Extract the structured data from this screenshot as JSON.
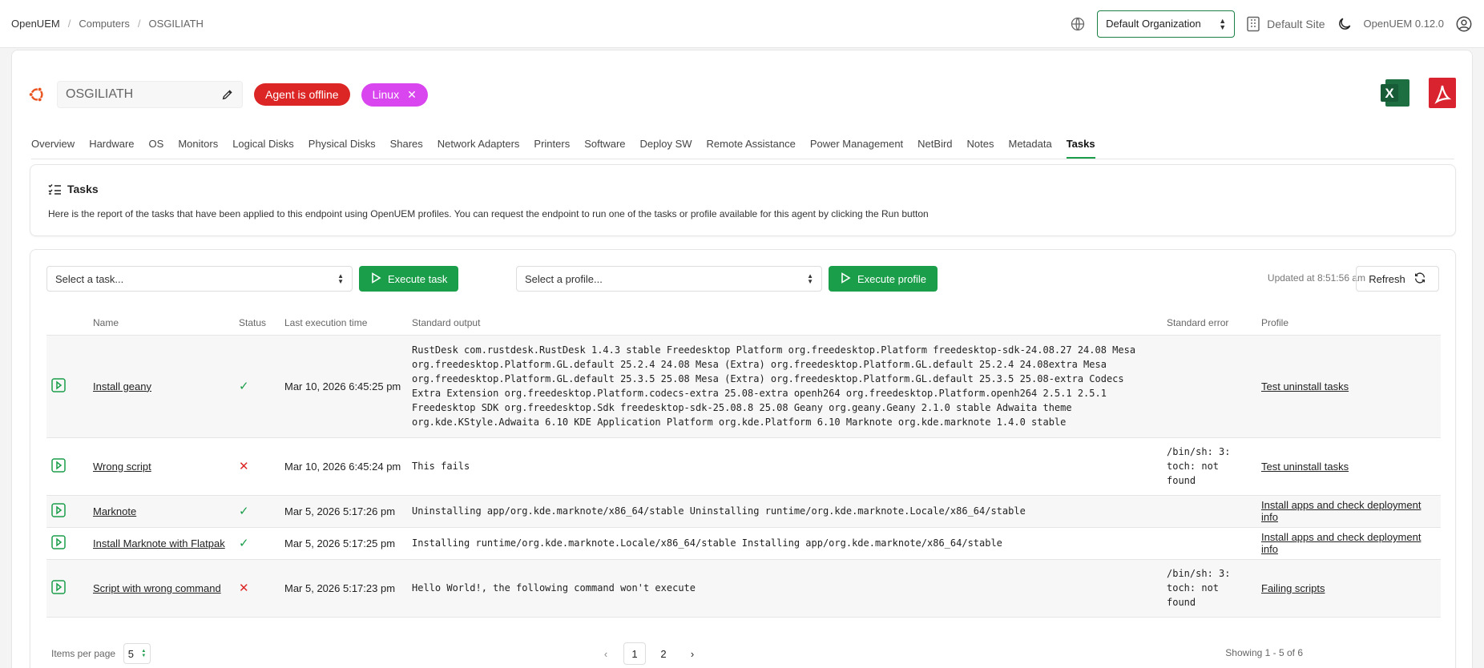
{
  "breadcrumb": {
    "items": [
      "OpenUEM",
      "Computers",
      "OSGILIATH"
    ]
  },
  "header": {
    "org_label": "Default Organization",
    "site_label": "Default Site",
    "version": "OpenUEM 0.12.0"
  },
  "endpoint": {
    "name": "OSGILIATH",
    "status_badge": "Agent is offline",
    "os_badge": "Linux"
  },
  "colors": {
    "accent": "#1a9e4a",
    "offline": "#dc2626",
    "os_badge": "#d946ef",
    "excel": "#1d6f42",
    "pdf": "#d9232e"
  },
  "tabs": [
    "Overview",
    "Hardware",
    "OS",
    "Monitors",
    "Logical Disks",
    "Physical Disks",
    "Shares",
    "Network Adapters",
    "Printers",
    "Software",
    "Deploy SW",
    "Remote Assistance",
    "Power Management",
    "NetBird",
    "Notes",
    "Metadata",
    "Tasks"
  ],
  "active_tab": "Tasks",
  "tasks_panel": {
    "title": "Tasks",
    "description": "Here is the report of the tasks that have been applied to this endpoint using OpenUEM profiles. You can request the endpoint to run one of the tasks or profile available for this agent by clicking the Run button"
  },
  "controls": {
    "task_select_placeholder": "Select a task...",
    "execute_task_label": "Execute task",
    "profile_select_placeholder": "Select a profile...",
    "execute_profile_label": "Execute profile",
    "updated_text": "Updated at 8:51:56 am",
    "refresh_label": "Refresh"
  },
  "table": {
    "columns": [
      "Name",
      "Status",
      "Last execution time",
      "Standard output",
      "Standard error",
      "Profile"
    ],
    "rows": [
      {
        "name": "Install geany",
        "status": "success",
        "time": "Mar 10, 2026 6:45:25 pm",
        "stdout": "RustDesk com.rustdesk.RustDesk 1.4.3 stable Freedesktop Platform org.freedesktop.Platform freedesktop-sdk-24.08.27 24.08 Mesa org.freedesktop.Platform.GL.default 25.2.4 24.08 Mesa (Extra) org.freedesktop.Platform.GL.default 25.2.4 24.08extra Mesa org.freedesktop.Platform.GL.default 25.3.5 25.08 Mesa (Extra) org.freedesktop.Platform.GL.default 25.3.5 25.08-extra Codecs Extra Extension org.freedesktop.Platform.codecs-extra 25.08-extra openh264 org.freedesktop.Platform.openh264 2.5.1 2.5.1 Freedesktop SDK org.freedesktop.Sdk freedesktop-sdk-25.08.8 25.08 Geany org.geany.Geany 2.1.0 stable Adwaita theme org.kde.KStyle.Adwaita 6.10 KDE Application Platform org.kde.Platform 6.10 Marknote org.kde.marknote 1.4.0 stable",
        "stderr": "",
        "profile": "Test uninstall tasks"
      },
      {
        "name": "Wrong script",
        "status": "failed",
        "time": "Mar 10, 2026 6:45:24 pm",
        "stdout": "This fails",
        "stderr": "/bin/sh: 3: toch: not found",
        "profile": "Test uninstall tasks"
      },
      {
        "name": "Marknote",
        "status": "success",
        "time": "Mar 5, 2026 5:17:26 pm",
        "stdout": "Uninstalling app/org.kde.marknote/x86_64/stable Uninstalling runtime/org.kde.marknote.Locale/x86_64/stable",
        "stderr": "",
        "profile": "Install apps and check deployment info"
      },
      {
        "name": "Install Marknote with Flatpak",
        "status": "success",
        "time": "Mar 5, 2026 5:17:25 pm",
        "stdout": "Installing runtime/org.kde.marknote.Locale/x86_64/stable Installing app/org.kde.marknote/x86_64/stable",
        "stderr": "",
        "profile": "Install apps and check deployment info"
      },
      {
        "name": "Script with wrong command",
        "status": "failed",
        "time": "Mar 5, 2026 5:17:23 pm",
        "stdout": "Hello World!, the following command won't execute",
        "stderr": "/bin/sh: 3: toch: not found",
        "profile": "Failing scripts"
      }
    ]
  },
  "pagination": {
    "items_per_page_label": "Items per page",
    "items_per_page": "5",
    "pages": [
      "1",
      "2"
    ],
    "current_page": "1",
    "showing": "Showing 1 - 5 of 6"
  }
}
